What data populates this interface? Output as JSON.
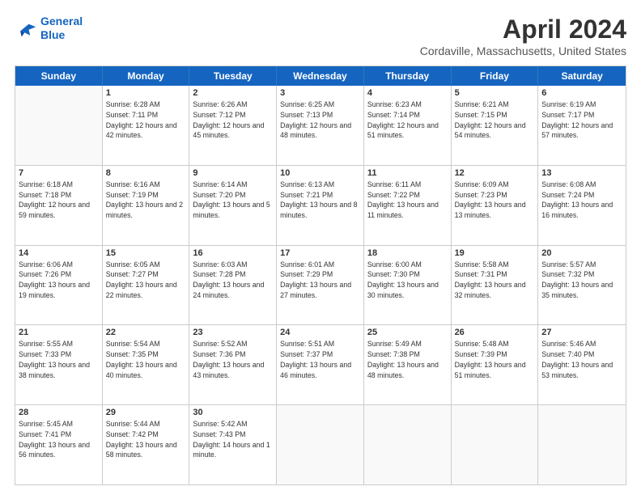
{
  "header": {
    "logo": {
      "line1": "General",
      "line2": "Blue"
    },
    "title": "April 2024",
    "subtitle": "Cordaville, Massachusetts, United States"
  },
  "days_of_week": [
    "Sunday",
    "Monday",
    "Tuesday",
    "Wednesday",
    "Thursday",
    "Friday",
    "Saturday"
  ],
  "weeks": [
    [
      {
        "day": "",
        "empty": true
      },
      {
        "day": "1",
        "sunrise": "6:28 AM",
        "sunset": "7:11 PM",
        "daylight": "12 hours and 42 minutes."
      },
      {
        "day": "2",
        "sunrise": "6:26 AM",
        "sunset": "7:12 PM",
        "daylight": "12 hours and 45 minutes."
      },
      {
        "day": "3",
        "sunrise": "6:25 AM",
        "sunset": "7:13 PM",
        "daylight": "12 hours and 48 minutes."
      },
      {
        "day": "4",
        "sunrise": "6:23 AM",
        "sunset": "7:14 PM",
        "daylight": "12 hours and 51 minutes."
      },
      {
        "day": "5",
        "sunrise": "6:21 AM",
        "sunset": "7:15 PM",
        "daylight": "12 hours and 54 minutes."
      },
      {
        "day": "6",
        "sunrise": "6:19 AM",
        "sunset": "7:17 PM",
        "daylight": "12 hours and 57 minutes."
      }
    ],
    [
      {
        "day": "7",
        "sunrise": "6:18 AM",
        "sunset": "7:18 PM",
        "daylight": "12 hours and 59 minutes."
      },
      {
        "day": "8",
        "sunrise": "6:16 AM",
        "sunset": "7:19 PM",
        "daylight": "13 hours and 2 minutes."
      },
      {
        "day": "9",
        "sunrise": "6:14 AM",
        "sunset": "7:20 PM",
        "daylight": "13 hours and 5 minutes."
      },
      {
        "day": "10",
        "sunrise": "6:13 AM",
        "sunset": "7:21 PM",
        "daylight": "13 hours and 8 minutes."
      },
      {
        "day": "11",
        "sunrise": "6:11 AM",
        "sunset": "7:22 PM",
        "daylight": "13 hours and 11 minutes."
      },
      {
        "day": "12",
        "sunrise": "6:09 AM",
        "sunset": "7:23 PM",
        "daylight": "13 hours and 13 minutes."
      },
      {
        "day": "13",
        "sunrise": "6:08 AM",
        "sunset": "7:24 PM",
        "daylight": "13 hours and 16 minutes."
      }
    ],
    [
      {
        "day": "14",
        "sunrise": "6:06 AM",
        "sunset": "7:26 PM",
        "daylight": "13 hours and 19 minutes."
      },
      {
        "day": "15",
        "sunrise": "6:05 AM",
        "sunset": "7:27 PM",
        "daylight": "13 hours and 22 minutes."
      },
      {
        "day": "16",
        "sunrise": "6:03 AM",
        "sunset": "7:28 PM",
        "daylight": "13 hours and 24 minutes."
      },
      {
        "day": "17",
        "sunrise": "6:01 AM",
        "sunset": "7:29 PM",
        "daylight": "13 hours and 27 minutes."
      },
      {
        "day": "18",
        "sunrise": "6:00 AM",
        "sunset": "7:30 PM",
        "daylight": "13 hours and 30 minutes."
      },
      {
        "day": "19",
        "sunrise": "5:58 AM",
        "sunset": "7:31 PM",
        "daylight": "13 hours and 32 minutes."
      },
      {
        "day": "20",
        "sunrise": "5:57 AM",
        "sunset": "7:32 PM",
        "daylight": "13 hours and 35 minutes."
      }
    ],
    [
      {
        "day": "21",
        "sunrise": "5:55 AM",
        "sunset": "7:33 PM",
        "daylight": "13 hours and 38 minutes."
      },
      {
        "day": "22",
        "sunrise": "5:54 AM",
        "sunset": "7:35 PM",
        "daylight": "13 hours and 40 minutes."
      },
      {
        "day": "23",
        "sunrise": "5:52 AM",
        "sunset": "7:36 PM",
        "daylight": "13 hours and 43 minutes."
      },
      {
        "day": "24",
        "sunrise": "5:51 AM",
        "sunset": "7:37 PM",
        "daylight": "13 hours and 46 minutes."
      },
      {
        "day": "25",
        "sunrise": "5:49 AM",
        "sunset": "7:38 PM",
        "daylight": "13 hours and 48 minutes."
      },
      {
        "day": "26",
        "sunrise": "5:48 AM",
        "sunset": "7:39 PM",
        "daylight": "13 hours and 51 minutes."
      },
      {
        "day": "27",
        "sunrise": "5:46 AM",
        "sunset": "7:40 PM",
        "daylight": "13 hours and 53 minutes."
      }
    ],
    [
      {
        "day": "28",
        "sunrise": "5:45 AM",
        "sunset": "7:41 PM",
        "daylight": "13 hours and 56 minutes."
      },
      {
        "day": "29",
        "sunrise": "5:44 AM",
        "sunset": "7:42 PM",
        "daylight": "13 hours and 58 minutes."
      },
      {
        "day": "30",
        "sunrise": "5:42 AM",
        "sunset": "7:43 PM",
        "daylight": "14 hours and 1 minute."
      },
      {
        "day": "",
        "empty": true
      },
      {
        "day": "",
        "empty": true
      },
      {
        "day": "",
        "empty": true
      },
      {
        "day": "",
        "empty": true
      }
    ]
  ]
}
